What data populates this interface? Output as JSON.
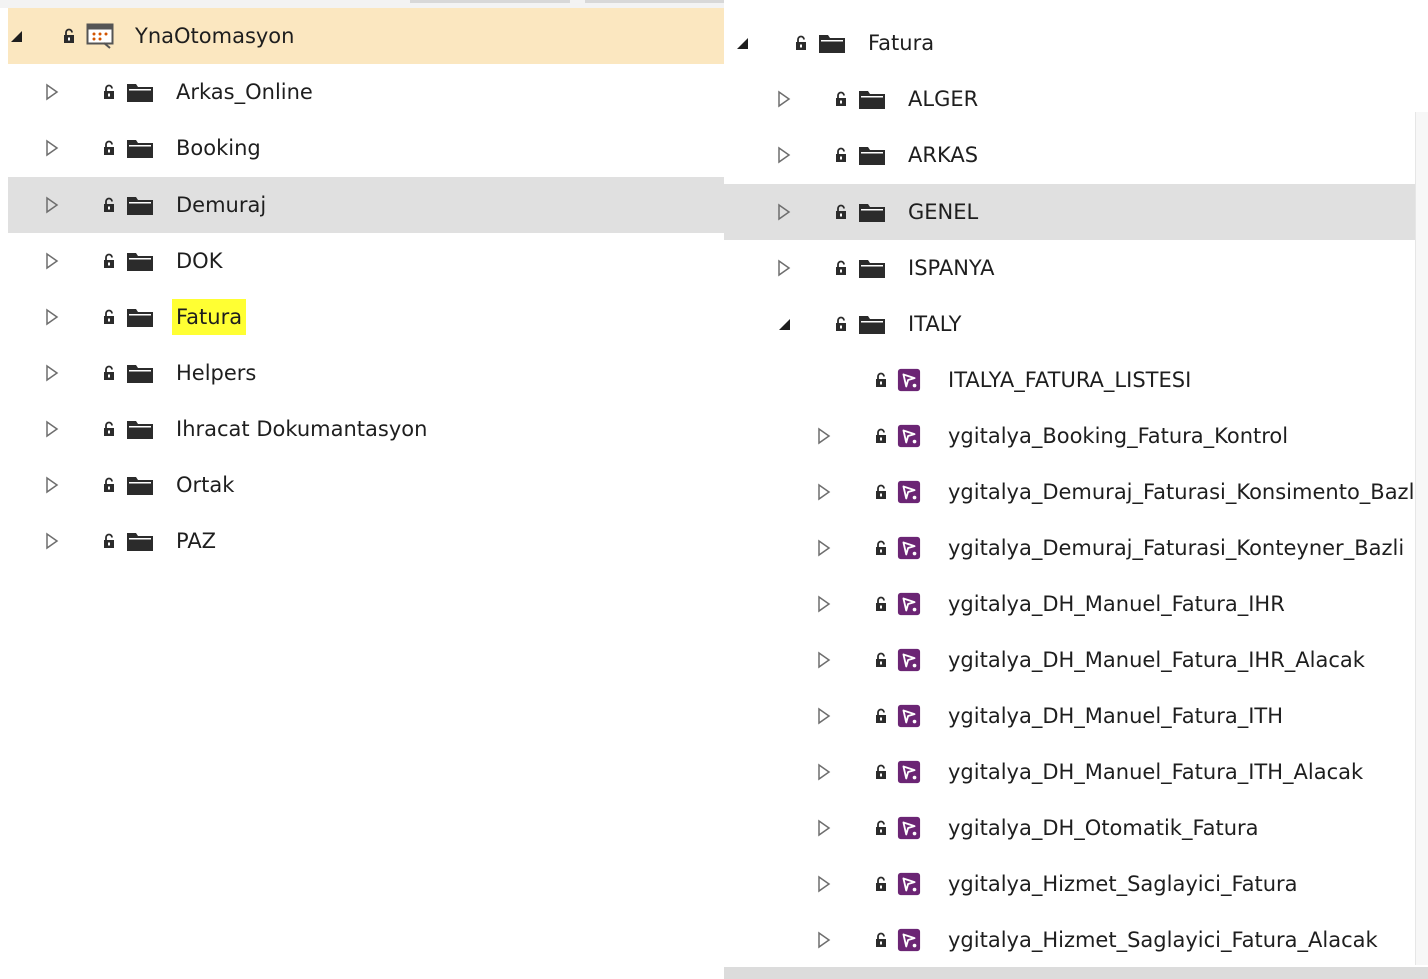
{
  "colors": {
    "root_selected_bg": "#fbe7c0",
    "hover_bg": "#e0e0e0",
    "highlight_yellow": "#ffff33",
    "process_icon_purple": "#6b2574",
    "folder_icon": "#2b2b2b"
  },
  "left_tree": {
    "root": {
      "label": "YnaOtomasyon",
      "icon": "project-icon"
    },
    "items": [
      {
        "label": "Arkas_Online",
        "icon": "folder-icon"
      },
      {
        "label": "Booking",
        "icon": "folder-icon"
      },
      {
        "label": "Demuraj",
        "icon": "folder-icon"
      },
      {
        "label": "DOK",
        "icon": "folder-icon"
      },
      {
        "label": "Fatura",
        "icon": "folder-icon"
      },
      {
        "label": "Helpers",
        "icon": "folder-icon"
      },
      {
        "label": "Ihracat Dokumantasyon",
        "icon": "folder-icon"
      },
      {
        "label": "Ortak",
        "icon": "folder-icon"
      },
      {
        "label": "PAZ",
        "icon": "folder-icon"
      }
    ]
  },
  "right_tree": {
    "root": {
      "label": "Fatura",
      "icon": "folder-icon"
    },
    "folders": [
      {
        "label": "ALGER",
        "icon": "folder-icon"
      },
      {
        "label": "ARKAS",
        "icon": "folder-icon"
      },
      {
        "label": "GENEL",
        "icon": "folder-icon"
      },
      {
        "label": "ISPANYA",
        "icon": "folder-icon"
      },
      {
        "label": "ITALY",
        "icon": "folder-icon"
      }
    ],
    "italy_children": [
      {
        "label": "ITALYA_FATURA_LISTESI",
        "icon": "process-icon"
      },
      {
        "label": "ygitalya_Booking_Fatura_Kontrol",
        "icon": "process-icon"
      },
      {
        "label": "ygitalya_Demuraj_Faturasi_Konsimento_Bazli",
        "icon": "process-icon"
      },
      {
        "label": "ygitalya_Demuraj_Faturasi_Konteyner_Bazli",
        "icon": "process-icon"
      },
      {
        "label": "ygitalya_DH_Manuel_Fatura_IHR",
        "icon": "process-icon"
      },
      {
        "label": "ygitalya_DH_Manuel_Fatura_IHR_Alacak",
        "icon": "process-icon"
      },
      {
        "label": "ygitalya_DH_Manuel_Fatura_ITH",
        "icon": "process-icon"
      },
      {
        "label": "ygitalya_DH_Manuel_Fatura_ITH_Alacak",
        "icon": "process-icon"
      },
      {
        "label": "ygitalya_DH_Otomatik_Fatura",
        "icon": "process-icon"
      },
      {
        "label": "ygitalya_Hizmet_Saglayici_Fatura",
        "icon": "process-icon"
      },
      {
        "label": "ygitalya_Hizmet_Saglayici_Fatura_Alacak",
        "icon": "process-icon"
      }
    ]
  }
}
